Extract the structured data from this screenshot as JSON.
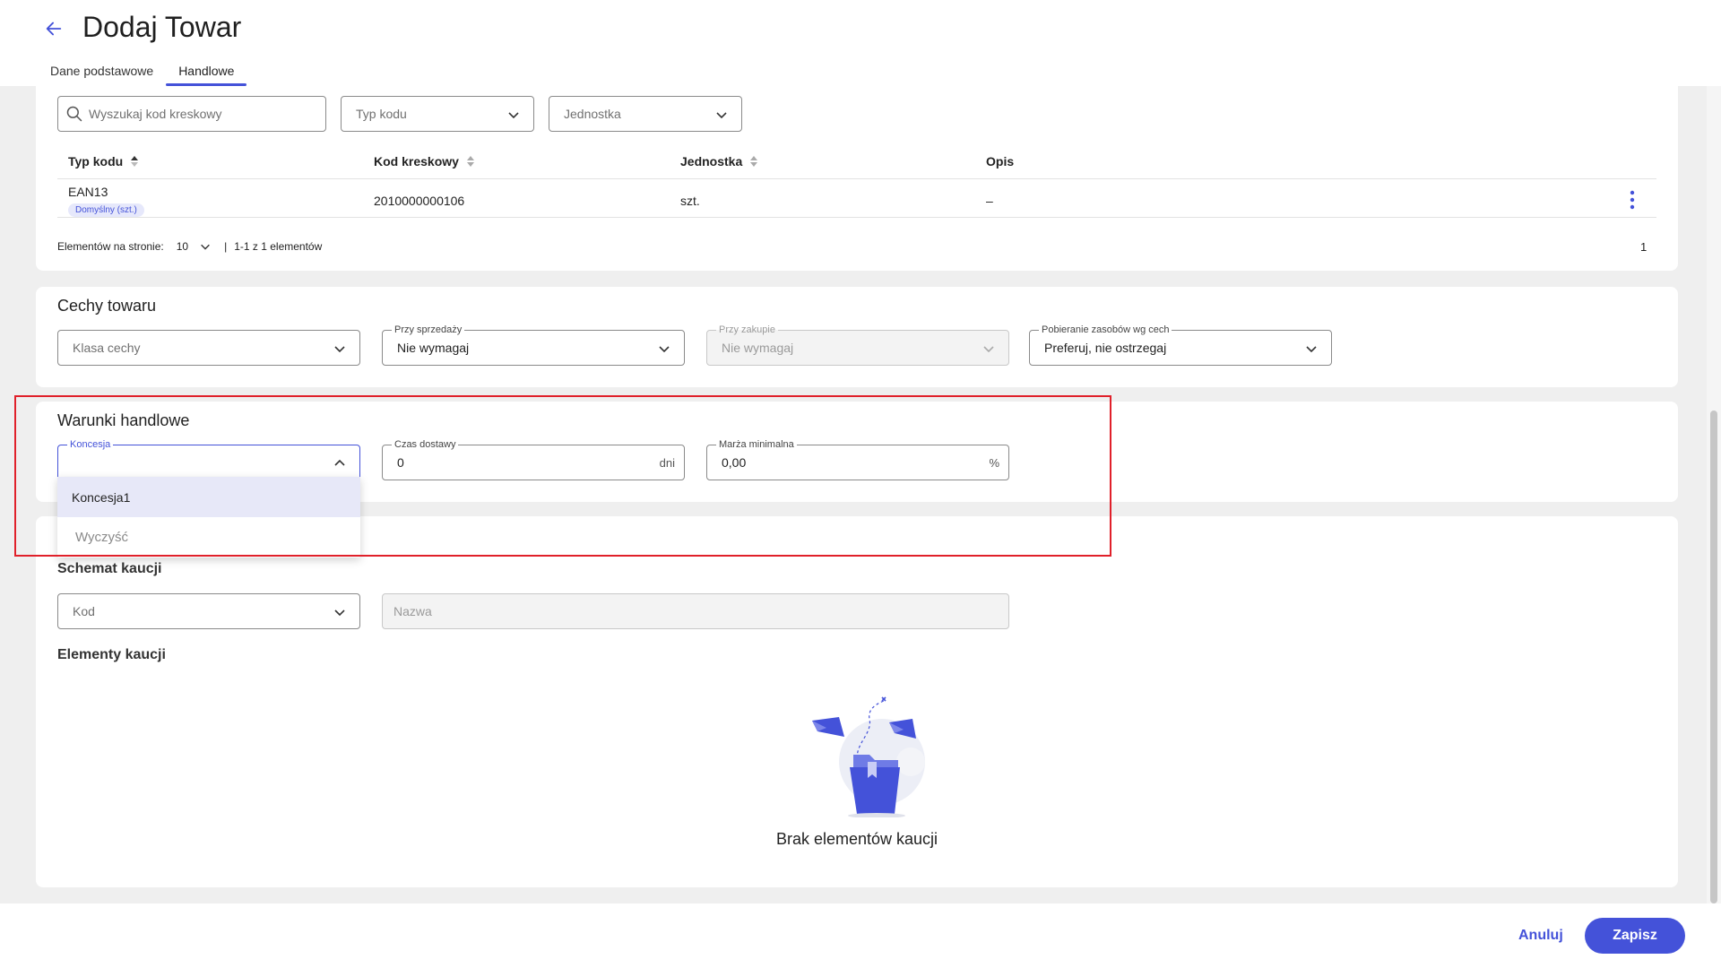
{
  "header": {
    "title": "Dodaj Towar",
    "tabs": [
      {
        "label": "Dane podstawowe"
      },
      {
        "label": "Handlowe"
      }
    ]
  },
  "barcodes": {
    "search_placeholder": "Wyszukaj kod kreskowy",
    "type_filter_placeholder": "Typ kodu",
    "unit_filter_placeholder": "Jednostka",
    "columns": [
      "Typ kodu",
      "Kod kreskowy",
      "Jednostka",
      "Opis"
    ],
    "rows": [
      {
        "type": "EAN13",
        "badge": "Domyślny (szt.)",
        "code": "2010000000106",
        "unit": "szt.",
        "desc": "–"
      }
    ],
    "pagination": {
      "per_page_label": "Elementów na stronie:",
      "per_page_value": "10",
      "range_text": "1-1 z 1 elementów",
      "page": "1"
    }
  },
  "features": {
    "title": "Cechy towaru",
    "class_placeholder": "Klasa cechy",
    "sale_label": "Przy sprzedaży",
    "sale_value": "Nie wymagaj",
    "purchase_label": "Przy zakupie",
    "purchase_value": "Nie wymagaj",
    "resources_label": "Pobieranie zasobów wg cech",
    "resources_value": "Preferuj, nie ostrzegaj"
  },
  "trade": {
    "title": "Warunki handlowe",
    "concession_label": "Koncesja",
    "concession_value": "",
    "delivery_label": "Czas dostawy",
    "delivery_value": "0",
    "delivery_unit": "dni",
    "margin_label": "Marża minimalna",
    "margin_value": "0,00",
    "margin_unit": "%",
    "dropdown_options": [
      "Koncesja1"
    ],
    "dropdown_clear": "Wyczyść"
  },
  "deposit": {
    "schema_title": "Schemat kaucji",
    "code_placeholder": "Kod",
    "name_placeholder": "Nazwa",
    "elements_title": "Elementy kaucji",
    "empty_text": "Brak elementów kaucji"
  },
  "footer": {
    "cancel_label": "Anuluj",
    "save_label": "Zapisz"
  },
  "colors": {
    "accent": "#4452d9",
    "highlight_border": "#e0202a"
  }
}
